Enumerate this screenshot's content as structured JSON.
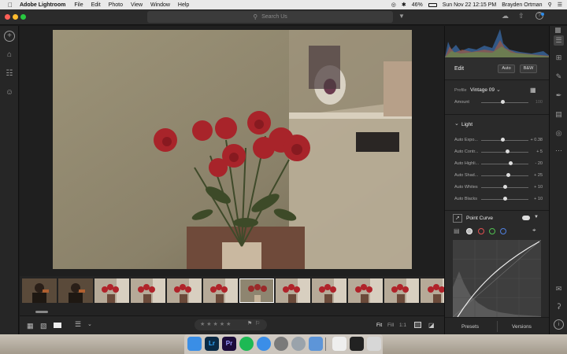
{
  "menubar": {
    "app_name": "Adobe Lightroom",
    "menus": [
      "File",
      "Edit",
      "Photo",
      "View",
      "Window",
      "Help"
    ],
    "battery": "46%",
    "datetime": "Sun Nov 22  12:15 PM",
    "user": "Brayden Ortman"
  },
  "search": {
    "placeholder": "Search Us"
  },
  "edit_panel": {
    "title": "Edit",
    "auto_label": "Auto",
    "bw_label": "B&W",
    "profile_label": "Profile",
    "profile_value": "Vintage 09",
    "amount_label": "Amount",
    "amount_value": "100",
    "light_section": "Light",
    "light_sliders": [
      {
        "label": "Auto Expo...",
        "value": "+ 0.38",
        "pos": 0.45
      },
      {
        "label": "Auto Contr...",
        "value": "+ 5",
        "pos": 0.55
      },
      {
        "label": "Auto Highli...",
        "value": "- 20",
        "pos": 0.62
      },
      {
        "label": "Auto Shad...",
        "value": "+ 25",
        "pos": 0.58
      },
      {
        "label": "Auto Whites",
        "value": "+ 10",
        "pos": 0.5
      },
      {
        "label": "Auto Blacks",
        "value": "+ 10",
        "pos": 0.5
      }
    ],
    "point_curve_label": "Point Curve"
  },
  "panel_tabs": {
    "presets": "Presets",
    "versions": "Versions"
  },
  "bottom_bar": {
    "fit": "Fit",
    "fill": "Fill",
    "one_to_one": "1:1",
    "stars": "★★★★★"
  },
  "dock_apps": [
    {
      "name": "finder",
      "label": "",
      "color": "#3a8ee6"
    },
    {
      "name": "lightroom",
      "label": "Lr",
      "color": "#0a2a45"
    },
    {
      "name": "premiere",
      "label": "Pr",
      "color": "#1c0c3a"
    },
    {
      "name": "spotify",
      "label": "",
      "color": "#1db954"
    },
    {
      "name": "safari",
      "label": "",
      "color": "#3b8ee8"
    },
    {
      "name": "system-prefs",
      "label": "",
      "color": "#7a7a7a"
    },
    {
      "name": "launchpad",
      "label": "",
      "color": "#9aa3ab"
    },
    {
      "name": "preview",
      "label": "",
      "color": "#5d95d8"
    },
    {
      "name": "notes",
      "label": "",
      "color": "#eeeeee"
    },
    {
      "name": "activity",
      "label": "",
      "color": "#222222"
    },
    {
      "name": "trash",
      "label": "",
      "color": "#d7d7d7"
    }
  ]
}
